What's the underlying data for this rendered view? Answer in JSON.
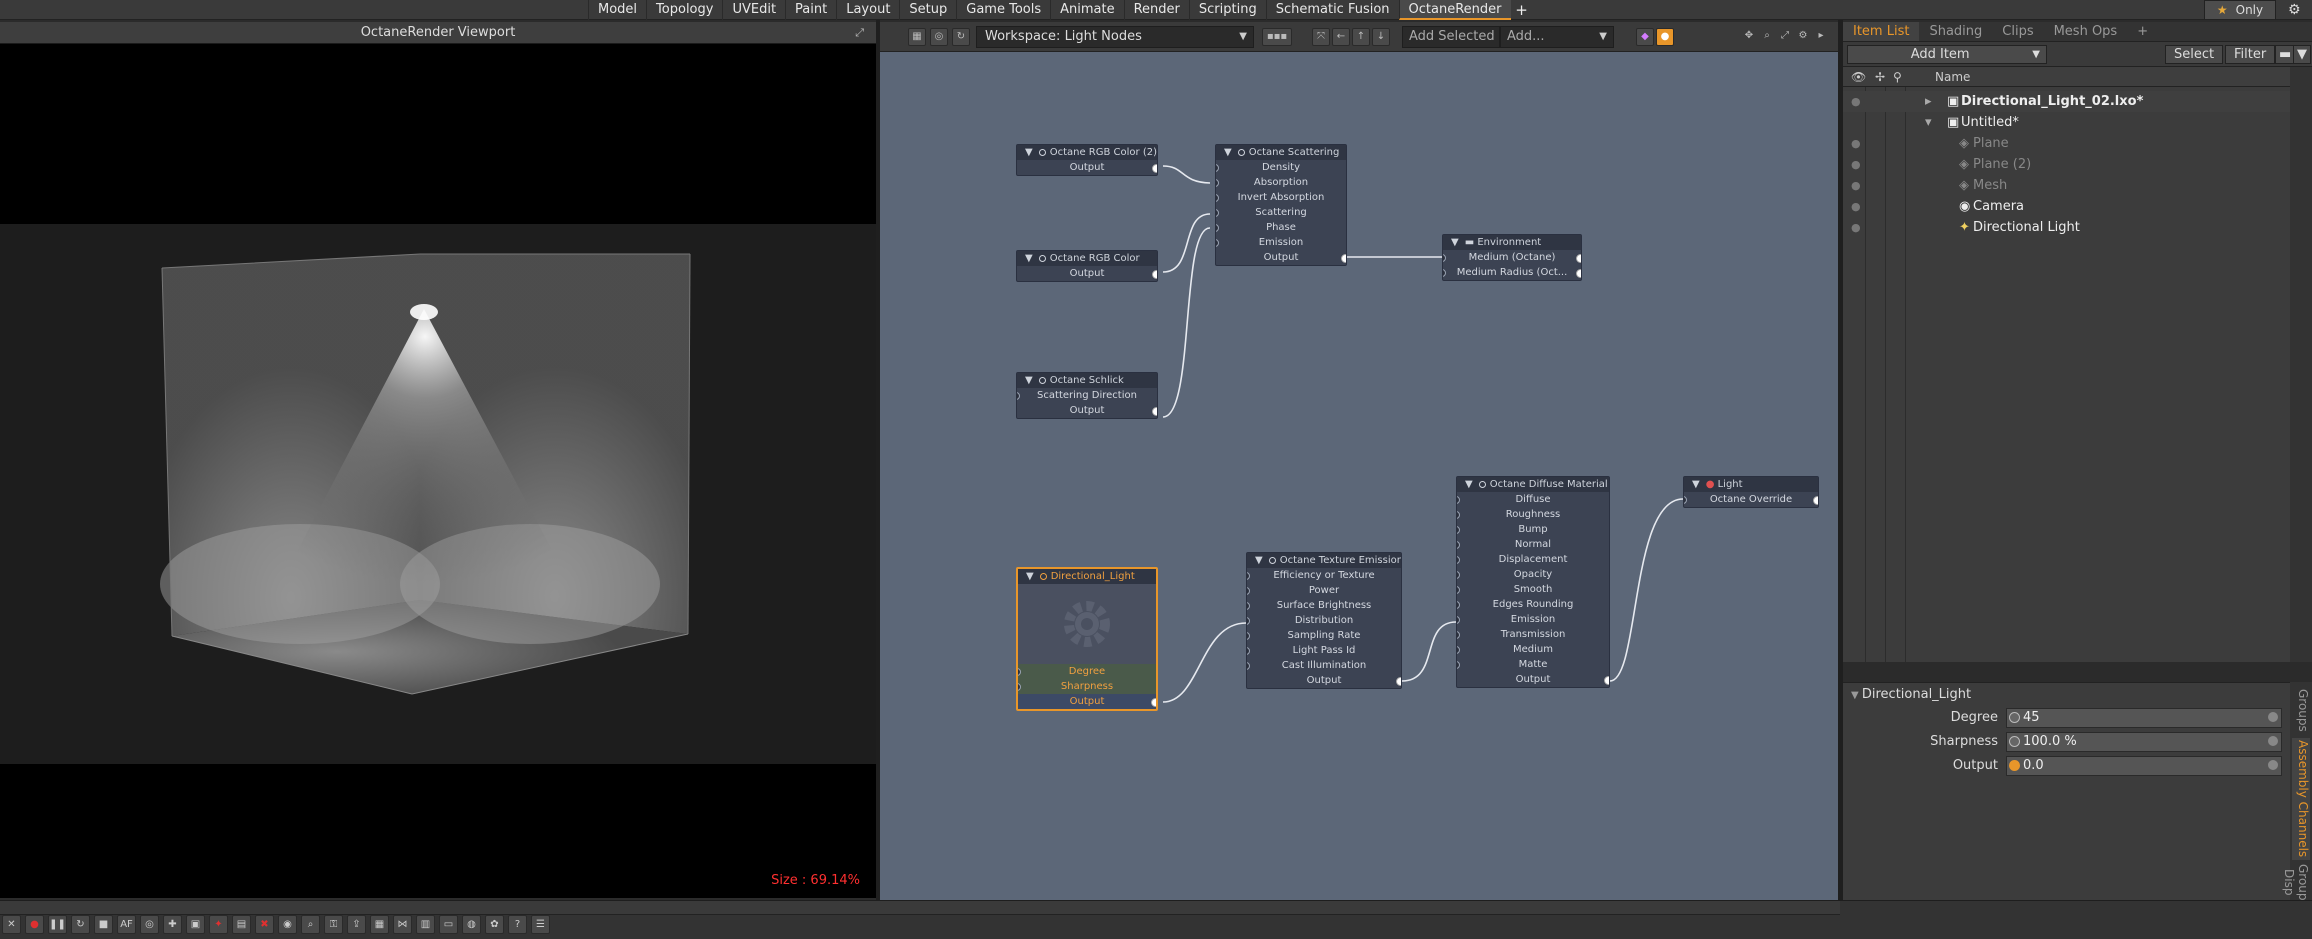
{
  "menubar": {
    "items": [
      "Model",
      "Topology",
      "UVEdit",
      "Paint",
      "Layout",
      "Setup",
      "Game Tools",
      "Animate",
      "Render",
      "Scripting",
      "Schematic Fusion",
      "OctaneRender"
    ],
    "active": "OctaneRender",
    "add_icon": "plus-icon",
    "only_label": "Only"
  },
  "viewport": {
    "title": "OctaneRender Viewport",
    "size_label": "Size : 69.14%"
  },
  "node_editor": {
    "workspace": "Workspace: Light Nodes",
    "add_selected": "Add Selected",
    "add_placeholder": "Add...",
    "nodes": {
      "rgb2": {
        "title": "Octane RGB Color (2)",
        "ports": [
          "Output"
        ]
      },
      "scatter": {
        "title": "Octane Scattering",
        "ports": [
          "Density",
          "Absorption",
          "Invert Absorption",
          "Scattering",
          "Phase",
          "Emission",
          "Output"
        ]
      },
      "rgb": {
        "title": "Octane RGB Color",
        "ports": [
          "Output"
        ]
      },
      "schlick": {
        "title": "Octane Schlick",
        "ports": [
          "Scattering Direction",
          "Output"
        ]
      },
      "env": {
        "title": "Environment",
        "ports": [
          "Medium (Octane)",
          "Medium Radius (Oct..."
        ]
      },
      "dirlight": {
        "title": "Directional_Light",
        "ports": [
          "Degree",
          "Sharpness",
          "Output"
        ]
      },
      "texemit": {
        "title": "Octane Texture Emission",
        "ports": [
          "Efficiency or Texture",
          "Power",
          "Surface Brightness",
          "Distribution",
          "Sampling Rate",
          "Light Pass Id",
          "Cast Illumination",
          "Output"
        ]
      },
      "diffuse": {
        "title": "Octane Diffuse Material",
        "ports": [
          "Diffuse",
          "Roughness",
          "Bump",
          "Normal",
          "Displacement",
          "Opacity",
          "Smooth",
          "Edges Rounding",
          "Emission",
          "Transmission",
          "Medium",
          "Matte",
          "Output"
        ]
      },
      "light": {
        "title": "Light",
        "ports": [
          "Octane Override"
        ]
      }
    }
  },
  "item_list": {
    "tabs": [
      "Item List",
      "Shading",
      "Clips",
      "Mesh Ops"
    ],
    "add_item": "Add Item",
    "select": "Select",
    "filter": "Filter",
    "col_name": "Name",
    "rows": [
      {
        "name": "Directional_Light_02.lxo*"
      },
      {
        "name": "Untitled*"
      },
      {
        "name": "Plane"
      },
      {
        "name": "Plane (2)"
      },
      {
        "name": "Mesh"
      },
      {
        "name": "Camera"
      },
      {
        "name": "Directional Light"
      }
    ]
  },
  "properties": {
    "title": "Directional_Light",
    "rows": [
      {
        "label": "Degree",
        "value": "45"
      },
      {
        "label": "Sharpness",
        "value": "100.0 %"
      },
      {
        "label": "Output",
        "value": "0.0"
      }
    ],
    "side_tabs": [
      "Groups",
      "Assembly Channels",
      "Group Disp"
    ]
  }
}
